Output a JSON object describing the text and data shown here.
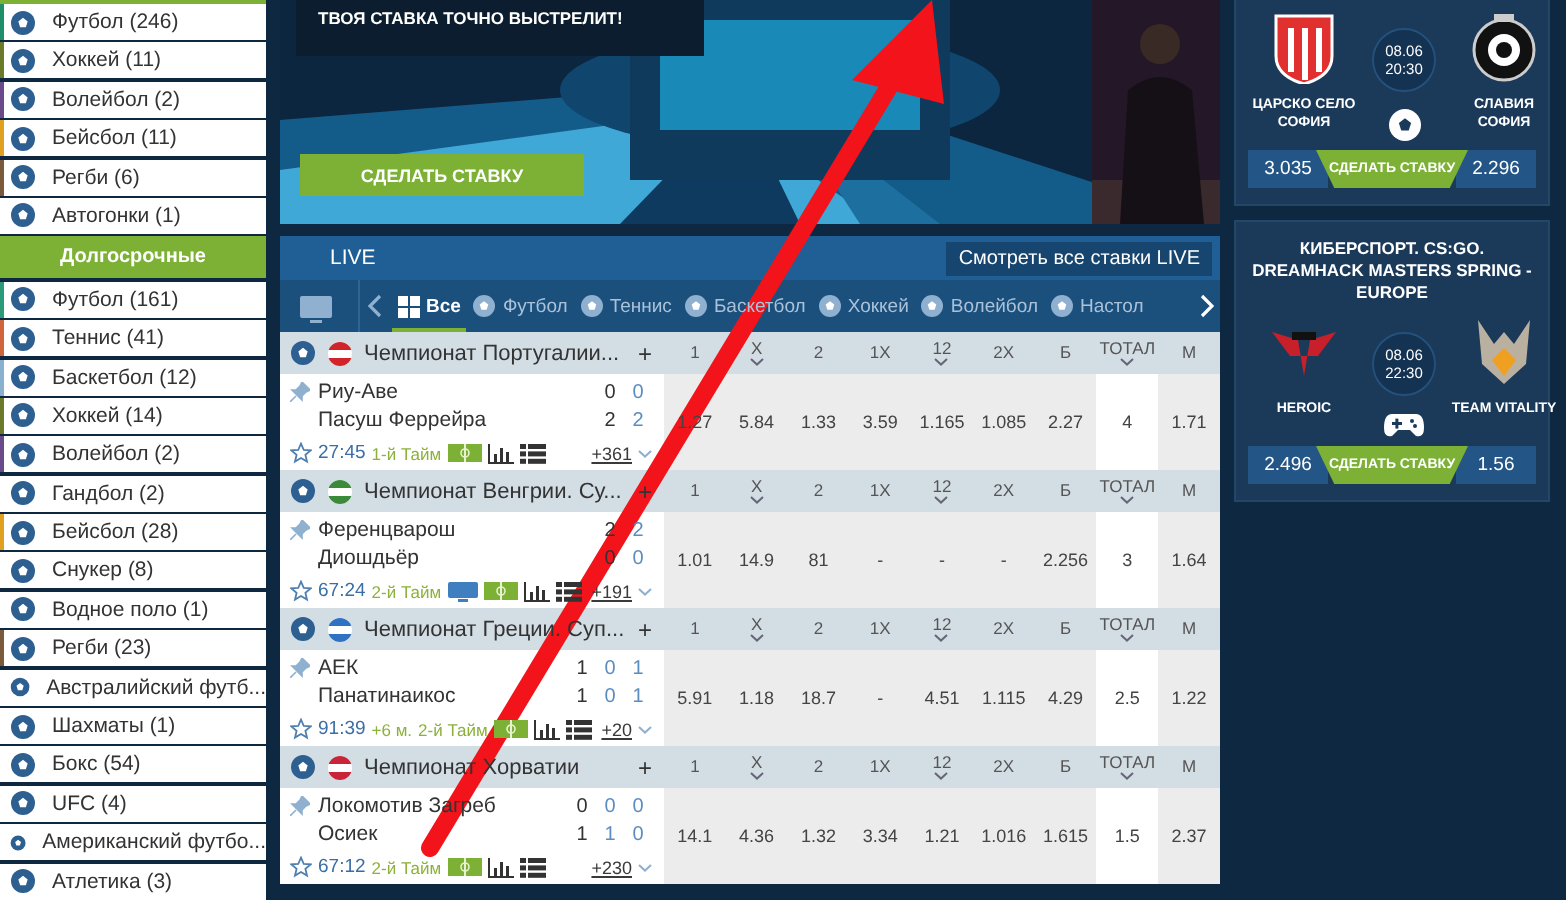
{
  "sidebar": {
    "live_items": [
      {
        "label": "Футбол (246)",
        "color": "#1f8f6a"
      },
      {
        "label": "Хоккей (11)",
        "color": "#6b7a2a"
      },
      {
        "label": "Волейбол (2)",
        "color": "#6a4a8a"
      },
      {
        "label": "Бейсбол (11)",
        "color": "#e0a020"
      },
      {
        "label": "Регби (6)",
        "color": "#7a5a3a"
      },
      {
        "label": "Автогонки (1)"
      }
    ],
    "section_header": "Долгосрочные",
    "long_term_items": [
      {
        "label": "Футбол (161)",
        "color": "#2a9a7a"
      },
      {
        "label": "Теннис (41)",
        "color": "#d0643a"
      },
      {
        "label": "Баскетбол (12)",
        "color": "#8ab0d0"
      },
      {
        "label": "Хоккей (14)",
        "color": "#6b7a2a"
      },
      {
        "label": "Волейбол (2)",
        "color": "#6a4a8a"
      },
      {
        "label": "Гандбол (2)"
      },
      {
        "label": "Бейсбол (28)",
        "color": "#e0a020"
      },
      {
        "label": "Снукер (8)"
      },
      {
        "label": "Водное поло (1)"
      },
      {
        "label": "Регби (23)",
        "color": "#7a5a3a"
      },
      {
        "label": "Австралийский футб..."
      },
      {
        "label": "Шахматы (1)"
      },
      {
        "label": "Бокс (54)"
      },
      {
        "label": "UFC (4)"
      },
      {
        "label": "Американский футбо..."
      },
      {
        "label": "Атлетика (3)"
      }
    ]
  },
  "banner": {
    "headline": "ТВОЯ СТАВКА ТОЧНО ВЫСТРЕЛИТ!",
    "button": "СДЕЛАТЬ СТАВКУ"
  },
  "live": {
    "title": "LIVE",
    "all_button": "Смотреть все ставки LIVE",
    "tabs": [
      {
        "label": "Все",
        "selected": true
      },
      {
        "label": "Футбол",
        "selected": false
      },
      {
        "label": "Теннис",
        "selected": false
      },
      {
        "label": "Баскетбол",
        "selected": false
      },
      {
        "label": "Хоккей",
        "selected": false
      },
      {
        "label": "Волейбол",
        "selected": false
      },
      {
        "label": "Настол",
        "selected": false
      }
    ],
    "leagues": [
      {
        "name": "Чемпионат Португалии...",
        "color": "#d0232a",
        "add": "+",
        "columns": [
          {
            "label": "1",
            "dropdown": false
          },
          {
            "label": "X",
            "dropdown": true
          },
          {
            "label": "2",
            "dropdown": false
          },
          {
            "label": "1X",
            "dropdown": false
          },
          {
            "label": "12",
            "dropdown": true
          },
          {
            "label": "2X",
            "dropdown": false
          },
          {
            "label": "Б",
            "dropdown": false
          },
          {
            "label": "ТОТАЛ",
            "dropdown": true
          },
          {
            "label": "М",
            "dropdown": false
          }
        ],
        "match": {
          "teams": [
            {
              "name": "Риу-Аве",
              "scores": [
                "0",
                "0"
              ]
            },
            {
              "name": "Пасуш Феррейра",
              "scores": [
                "2",
                "2"
              ]
            }
          ],
          "time": "27:45",
          "period": "1-й Тайм",
          "live_stream": false,
          "more": "+361",
          "odds": [
            "1.27",
            "5.84",
            "1.33",
            "3.59",
            "1.165",
            "1.085",
            "2.27",
            "4",
            "1.71"
          ]
        }
      },
      {
        "name": "Чемпионат Венгрии. Су...",
        "color": "#3a8a3a",
        "add": "+",
        "columns": [
          {
            "label": "1",
            "dropdown": false
          },
          {
            "label": "X",
            "dropdown": true
          },
          {
            "label": "2",
            "dropdown": false
          },
          {
            "label": "1X",
            "dropdown": false
          },
          {
            "label": "12",
            "dropdown": true
          },
          {
            "label": "2X",
            "dropdown": false
          },
          {
            "label": "Б",
            "dropdown": false
          },
          {
            "label": "ТОТАЛ",
            "dropdown": true
          },
          {
            "label": "М",
            "dropdown": false
          }
        ],
        "match": {
          "teams": [
            {
              "name": "Ференцварош",
              "scores": [
                "2",
                "2"
              ]
            },
            {
              "name": "Диошдьёр",
              "scores": [
                "0",
                "0"
              ]
            }
          ],
          "time": "67:24",
          "period": "2-й Тайм",
          "live_stream": true,
          "more": "+191",
          "odds": [
            "1.01",
            "14.9",
            "81",
            "-",
            "-",
            "-",
            "2.256",
            "3",
            "1.64"
          ]
        }
      },
      {
        "name": "Чемпионат Греции. Суп...",
        "color": "#2f72c4",
        "add": "+",
        "columns": [
          {
            "label": "1",
            "dropdown": false
          },
          {
            "label": "X",
            "dropdown": true
          },
          {
            "label": "2",
            "dropdown": false
          },
          {
            "label": "1X",
            "dropdown": false
          },
          {
            "label": "12",
            "dropdown": true
          },
          {
            "label": "2X",
            "dropdown": false
          },
          {
            "label": "Б",
            "dropdown": false
          },
          {
            "label": "ТОТАЛ",
            "dropdown": true
          },
          {
            "label": "М",
            "dropdown": false
          }
        ],
        "match": {
          "teams": [
            {
              "name": "АЕК",
              "scores": [
                "1",
                "0",
                "1"
              ]
            },
            {
              "name": "Панатинаикос",
              "scores": [
                "1",
                "0",
                "1"
              ]
            }
          ],
          "time": "91:39",
          "extra_time": "+6 м.",
          "period": "2-й Тайм",
          "live_stream": false,
          "more": "+20",
          "odds": [
            "5.91",
            "1.18",
            "18.7",
            "-",
            "4.51",
            "1.115",
            "4.29",
            "2.5",
            "1.22"
          ]
        }
      },
      {
        "name": "Чемпионат Хорватии",
        "color": "#c8243a",
        "add": "+",
        "columns": [
          {
            "label": "1",
            "dropdown": false
          },
          {
            "label": "X",
            "dropdown": true
          },
          {
            "label": "2",
            "dropdown": false
          },
          {
            "label": "1X",
            "dropdown": false
          },
          {
            "label": "12",
            "dropdown": true
          },
          {
            "label": "2X",
            "dropdown": false
          },
          {
            "label": "Б",
            "dropdown": false
          },
          {
            "label": "ТОТАЛ",
            "dropdown": true
          },
          {
            "label": "М",
            "dropdown": false
          }
        ],
        "match": {
          "teams": [
            {
              "name": "Локомотив Загреб",
              "scores": [
                "0",
                "0",
                "0"
              ]
            },
            {
              "name": "Осиек",
              "scores": [
                "1",
                "1",
                "0"
              ]
            }
          ],
          "time": "67:12",
          "period": "2-й Тайм",
          "live_stream": false,
          "more": "+230",
          "odds": [
            "14.1",
            "4.36",
            "1.32",
            "3.34",
            "1.21",
            "1.016",
            "1.615",
            "1.5",
            "2.37"
          ]
        }
      }
    ]
  },
  "promo_cards": [
    {
      "kind": "football",
      "home": "ЦАРСКО СЕЛО СОФИЯ",
      "away": "СЛАВИЯ СОФИЯ",
      "date": "08.06",
      "time": "20:30",
      "odds_home": "3.035",
      "button": "СДЕЛАТЬ СТАВКУ",
      "odds_away": "2.296"
    },
    {
      "kind": "esports",
      "title": "КИБЕРСПОРТ. CS:GO. DREAMHACK MASTERS SPRING - EUROPE",
      "home": "HEROIC",
      "away": "TEAM VITALITY",
      "date": "08.06",
      "time": "22:30",
      "odds_home": "2.496",
      "button": "СДЕЛАТЬ СТАВКУ",
      "odds_away": "1.56"
    }
  ]
}
